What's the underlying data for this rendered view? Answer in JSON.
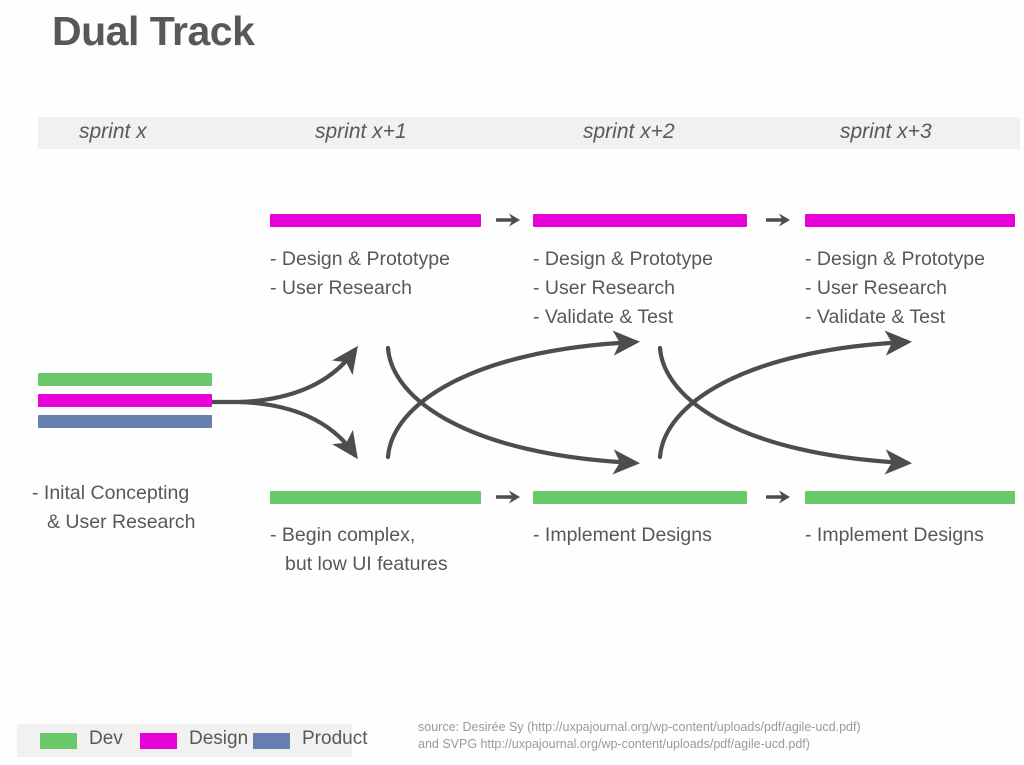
{
  "slide": {
    "title": "Dual Track",
    "background_color": "#fefefe",
    "text_color": "#58585a"
  },
  "colors": {
    "dev": "#68c86a",
    "design": "#e800d9",
    "product": "#6880b0",
    "header_band": "#f1f1f1",
    "arrow": "#4d4d4f",
    "source_text": "#9a9a9a"
  },
  "sprint_headers": [
    {
      "label": "sprint x"
    },
    {
      "label": "sprint x+1"
    },
    {
      "label": "sprint x+2"
    },
    {
      "label": "sprint x+3"
    }
  ],
  "columns": {
    "sprint_x": {
      "bars": [
        {
          "track": "dev",
          "color": "#68c86a"
        },
        {
          "track": "design",
          "color": "#e800d9"
        },
        {
          "track": "product",
          "color": "#6880b0"
        }
      ],
      "text_lines": [
        "- Inital Concepting",
        "& User Research"
      ]
    },
    "sprint_x1": {
      "design_track": {
        "bar_color": "#e800d9",
        "text_lines": [
          "- Design & Prototype",
          "- User Research"
        ]
      },
      "dev_track": {
        "bar_color": "#68c86a",
        "text_lines": [
          "- Begin complex,",
          "but low UI features"
        ]
      }
    },
    "sprint_x2": {
      "design_track": {
        "bar_color": "#e800d9",
        "text_lines": [
          "- Design & Prototype",
          "- User Research",
          "- Validate & Test"
        ]
      },
      "dev_track": {
        "bar_color": "#68c86a",
        "text_lines": [
          "- Implement Designs"
        ]
      }
    },
    "sprint_x3": {
      "design_track": {
        "bar_color": "#e800d9",
        "text_lines": [
          "- Design & Prototype",
          "- User Research",
          "- Validate & Test"
        ]
      },
      "dev_track": {
        "bar_color": "#68c86a",
        "text_lines": [
          "- Implement Designs"
        ]
      }
    }
  },
  "legend": {
    "items": [
      {
        "label": "Dev",
        "color": "#68c86a"
      },
      {
        "label": "Design",
        "color": "#e800d9"
      },
      {
        "label": "Product",
        "color": "#6880b0"
      }
    ]
  },
  "source": {
    "line1": "source: Desirée Sy (http://uxpajournal.org/wp-content/uploads/pdf/agile-ucd.pdf)",
    "line2": "and SVPG http://uxpajournal.org/wp-content/uploads/pdf/agile-ucd.pdf)"
  },
  "diagram_data": {
    "type": "process-flow",
    "tracks": [
      "Design",
      "Dev",
      "Product"
    ],
    "phases": [
      "sprint x",
      "sprint x+1",
      "sprint x+2",
      "sprint x+3"
    ],
    "flow_arrows": [
      "sprint x -> sprint x+1 design (fork up)",
      "sprint x -> sprint x+1 dev (fork down)",
      "sprint x+1 design -> sprint x+2 dev (cross down)",
      "sprint x+1 dev -> sprint x+2 design (cross up)",
      "sprint x+2 design -> sprint x+3 dev (cross down)",
      "sprint x+2 dev -> sprint x+3 design (cross up)",
      "sprint x+1 design -> sprint x+2 design (straight)",
      "sprint x+2 design -> sprint x+3 design (straight)",
      "sprint x+1 dev -> sprint x+2 dev (straight)",
      "sprint x+2 dev -> sprint x+3 dev (straight)"
    ]
  }
}
